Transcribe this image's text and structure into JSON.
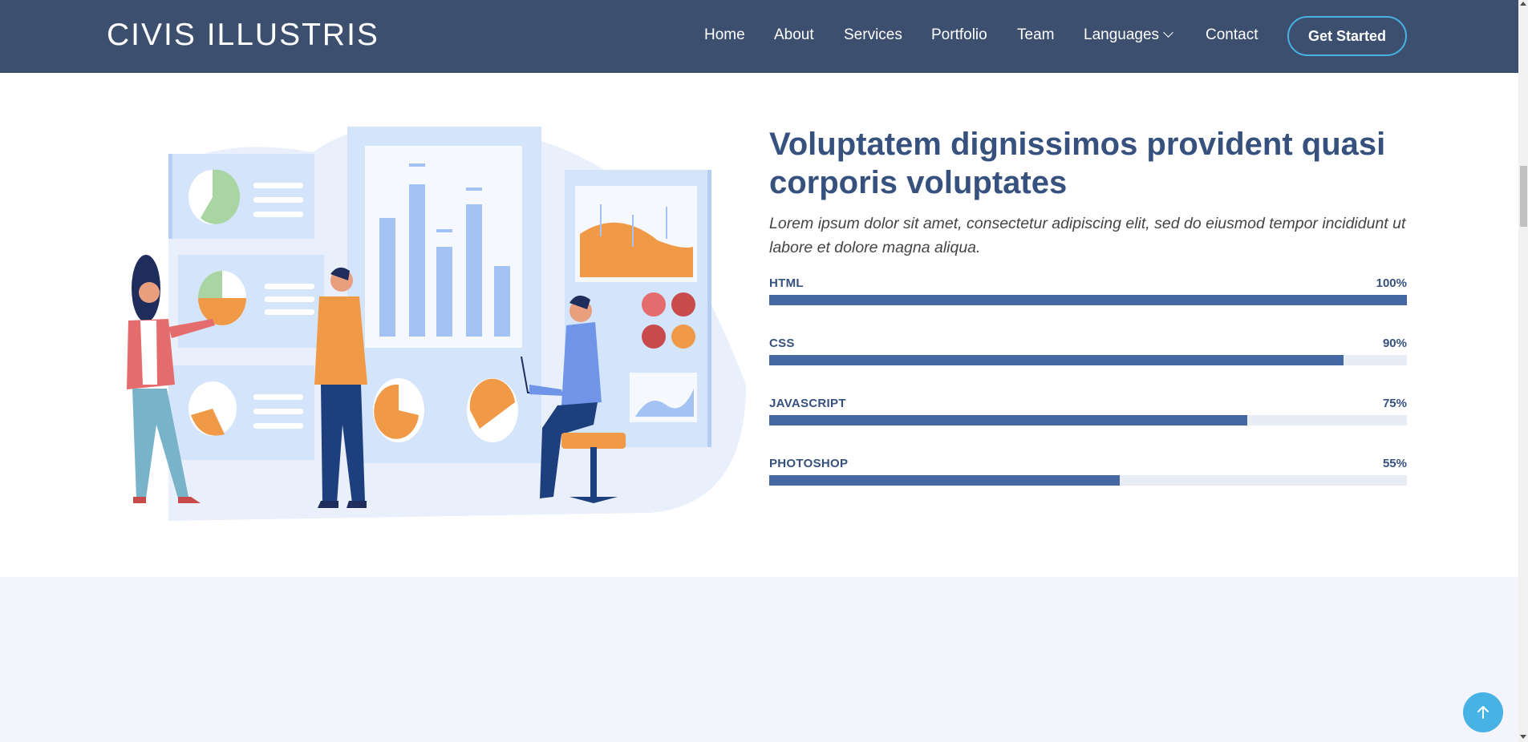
{
  "header": {
    "logo": "CIVIS ILLUSTRIS",
    "nav": [
      {
        "label": "Home"
      },
      {
        "label": "About"
      },
      {
        "label": "Services"
      },
      {
        "label": "Portfolio"
      },
      {
        "label": "Team"
      },
      {
        "label": "Languages"
      },
      {
        "label": "Contact"
      }
    ],
    "cta_label": "Get Started"
  },
  "skills_section": {
    "title": "Voluptatem dignissimos provident quasi corporis voluptates",
    "lead": "Lorem ipsum dolor sit amet, consectetur adipiscing elit, sed do eiusmod tempor incididunt ut labore et dolore magna aliqua.",
    "skills": [
      {
        "name": "HTML",
        "value_label": "100%",
        "percent": 100
      },
      {
        "name": "CSS",
        "value_label": "90%",
        "percent": 90
      },
      {
        "name": "JAVASCRIPT",
        "value_label": "75%",
        "percent": 75
      },
      {
        "name": "PHOTOSHOP",
        "value_label": "55%",
        "percent": 55
      }
    ]
  },
  "colors": {
    "header_bg": "#3d4f6e",
    "accent": "#47b2e4",
    "heading": "#37517e",
    "bar_fill": "#4668a2",
    "bar_track": "#e8edf5",
    "section_alt_bg": "#f3f5fa"
  },
  "icons": {
    "languages_dropdown": "chevron-down-icon",
    "back_to_top": "arrow-up-icon"
  }
}
